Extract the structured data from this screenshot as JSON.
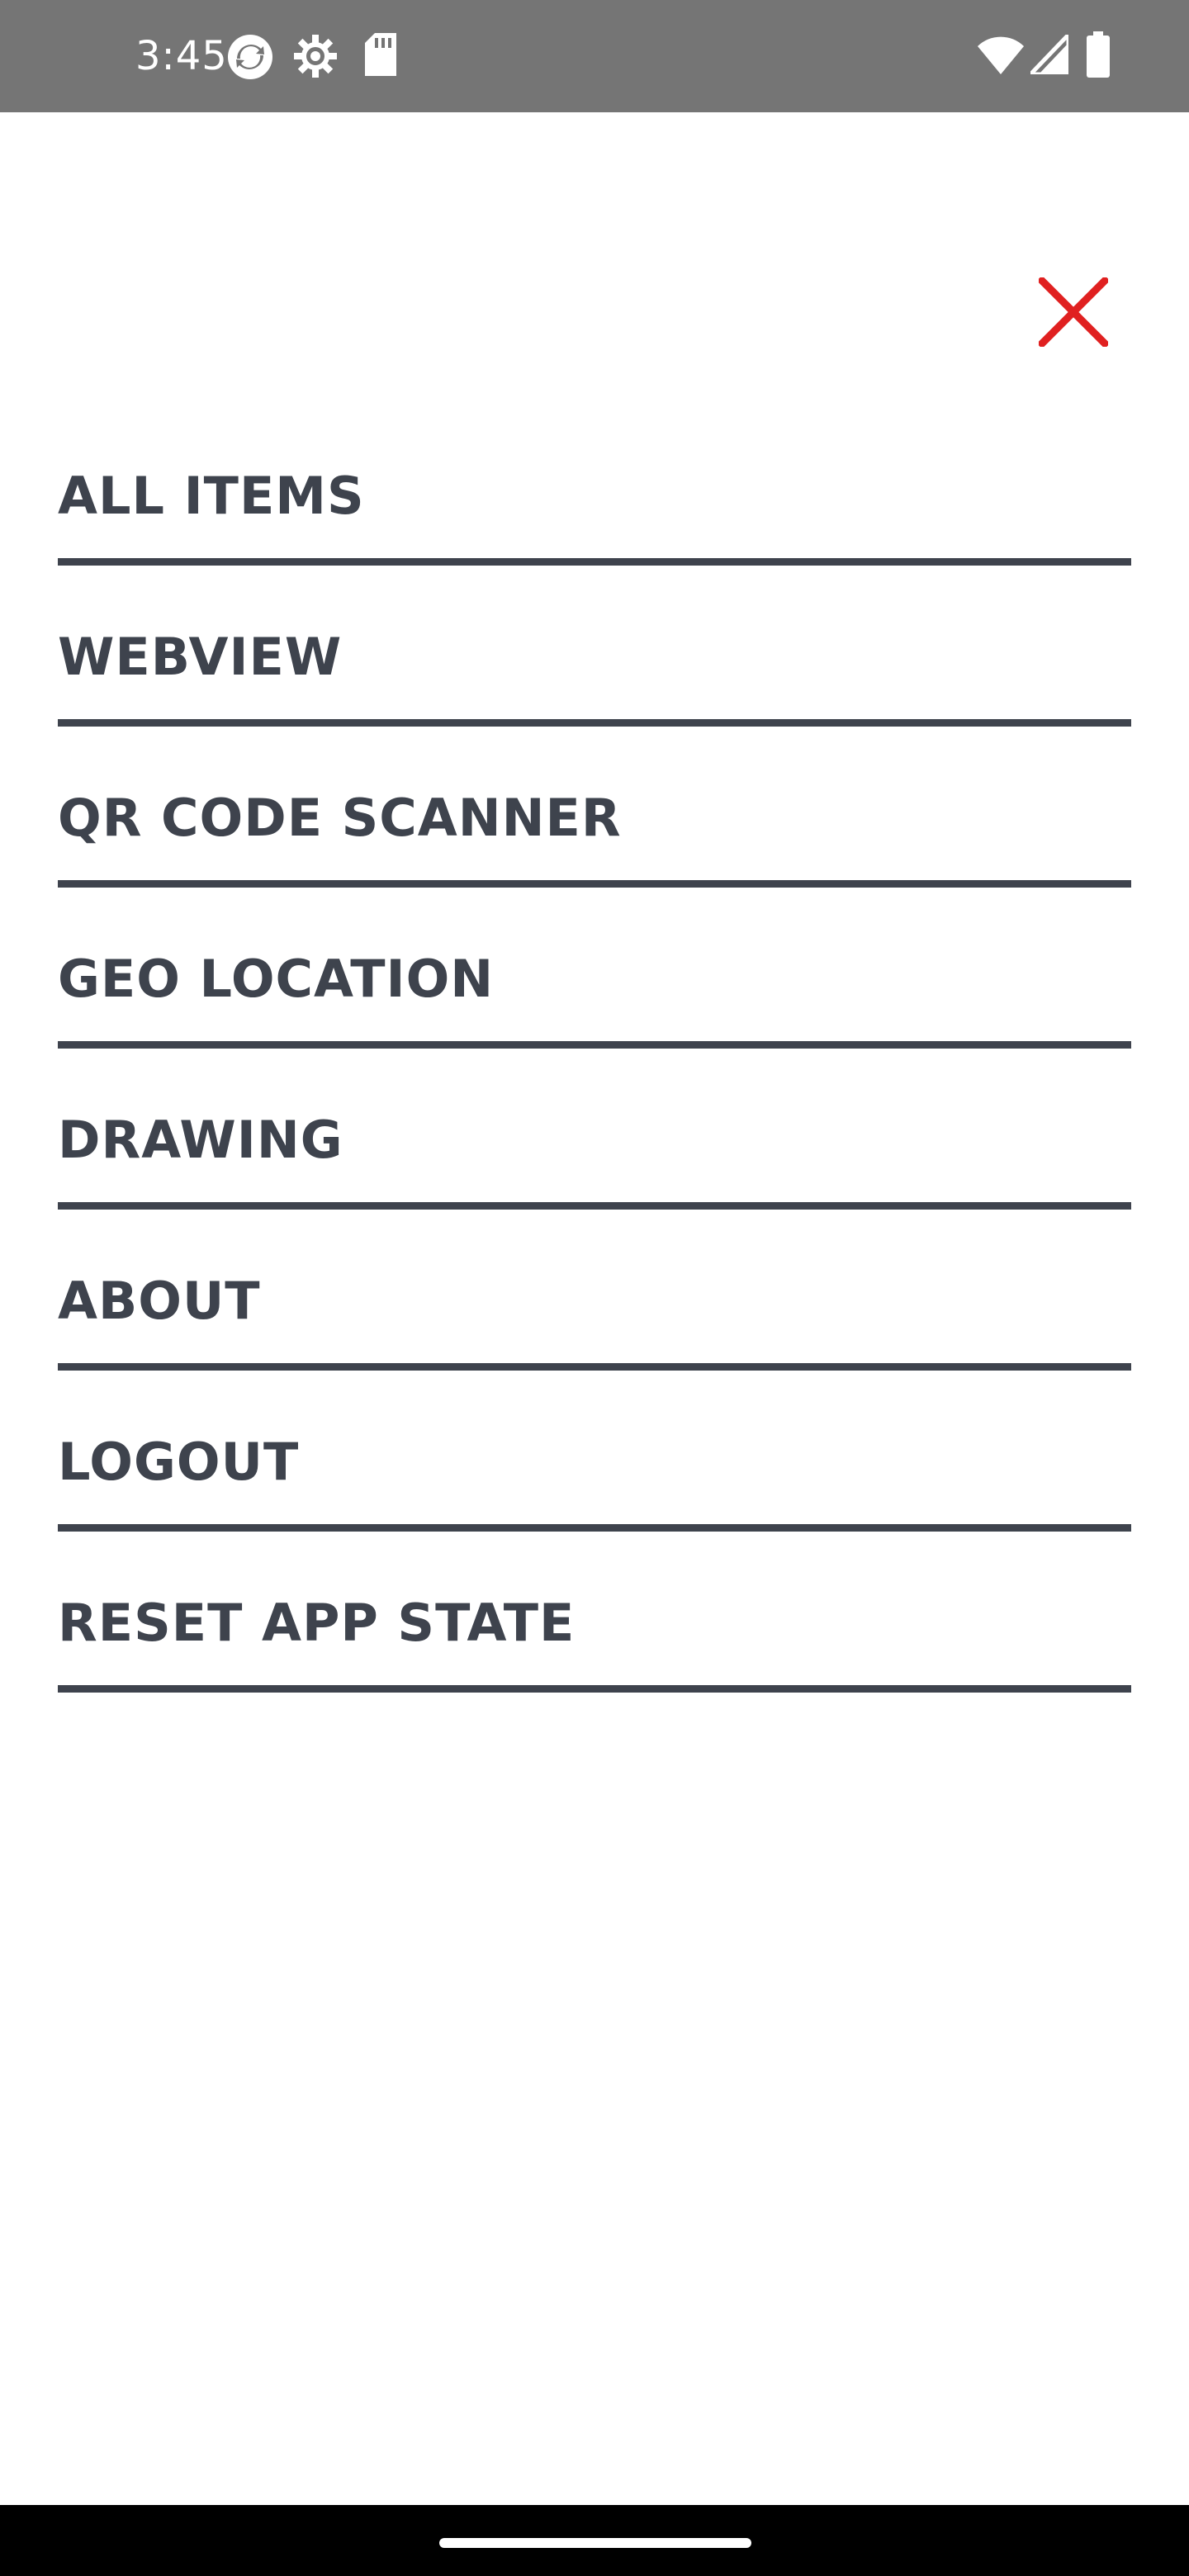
{
  "status_bar": {
    "time": "3:45",
    "icons": [
      "sync-icon",
      "settings-gear-icon",
      "sd-card-icon",
      "wifi-icon",
      "cellular-signal-icon",
      "battery-icon"
    ]
  },
  "close_button": {
    "icon": "close-icon",
    "color": "#e02020"
  },
  "menu": {
    "items": [
      {
        "id": "all-items",
        "label": "ALL ITEMS"
      },
      {
        "id": "webview",
        "label": "WEBVIEW"
      },
      {
        "id": "qr-code-scanner",
        "label": "QR CODE SCANNER"
      },
      {
        "id": "geo-location",
        "label": "GEO LOCATION"
      },
      {
        "id": "drawing",
        "label": "DRAWING"
      },
      {
        "id": "about",
        "label": "ABOUT"
      },
      {
        "id": "logout",
        "label": "LOGOUT"
      },
      {
        "id": "reset-app-state",
        "label": "RESET APP STATE"
      }
    ]
  },
  "colors": {
    "status_bar_bg": "#757575",
    "menu_text": "#3e434d",
    "divider": "#3e434d",
    "accent_red": "#e02020",
    "nav_bar_bg": "#000000"
  }
}
